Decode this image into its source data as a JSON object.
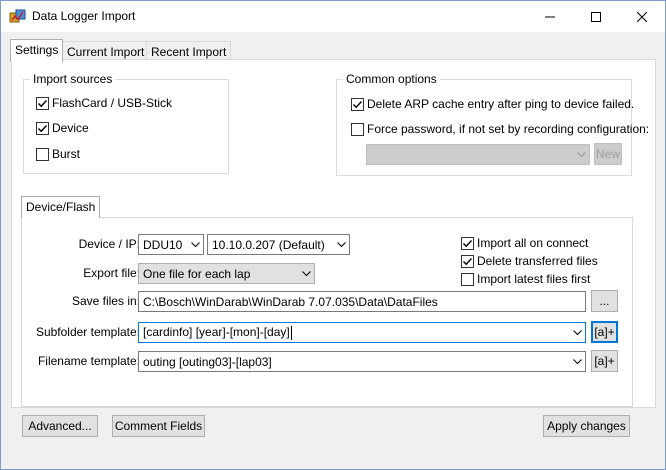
{
  "window": {
    "title": "Data Logger Import"
  },
  "tabs": [
    {
      "label": "Settings"
    },
    {
      "label": "Current Import"
    },
    {
      "label": "Recent Import"
    }
  ],
  "import_sources": {
    "title": "Import sources",
    "items": [
      {
        "label": "FlashCard / USB-Stick",
        "checked": true
      },
      {
        "label": "Device",
        "checked": true
      },
      {
        "label": "Burst",
        "checked": false
      }
    ]
  },
  "common_options": {
    "title": "Common options",
    "delete_arp": {
      "label": "Delete ARP cache entry after ping to device failed.",
      "checked": true
    },
    "force_password": {
      "label": "Force password, if not set by recording configuration:",
      "checked": false
    },
    "password_combo_value": "",
    "new_button": "New"
  },
  "device_flash": {
    "tab_label": "Device/Flash",
    "device_ip_label": "Device / IP:",
    "device_value": "DDU10",
    "ip_value": "10.10.0.207 (Default)",
    "export_file_label": "Export file:",
    "export_file_value": "One file for each lap",
    "save_files_label": "Save files in:",
    "save_files_value": "C:\\Bosch\\WinDarab\\WinDarab 7.07.035\\Data\\DataFiles",
    "browse_button": "...",
    "subfolder_label": "Subfolder template:",
    "subfolder_value": "[cardinfo] [year]-[mon]-[day]",
    "filename_label": "Filename template:",
    "filename_value": "outing [outing03]-[lap03]",
    "macro_button": "[a]+",
    "options": [
      {
        "label": "Import all on connect",
        "checked": true
      },
      {
        "label": "Delete transferred files",
        "checked": true
      },
      {
        "label": "Import latest files first",
        "checked": false
      }
    ]
  },
  "footer": {
    "advanced_button": "Advanced...",
    "comment_fields_button": "Comment Fields",
    "apply_button": "Apply changes"
  }
}
